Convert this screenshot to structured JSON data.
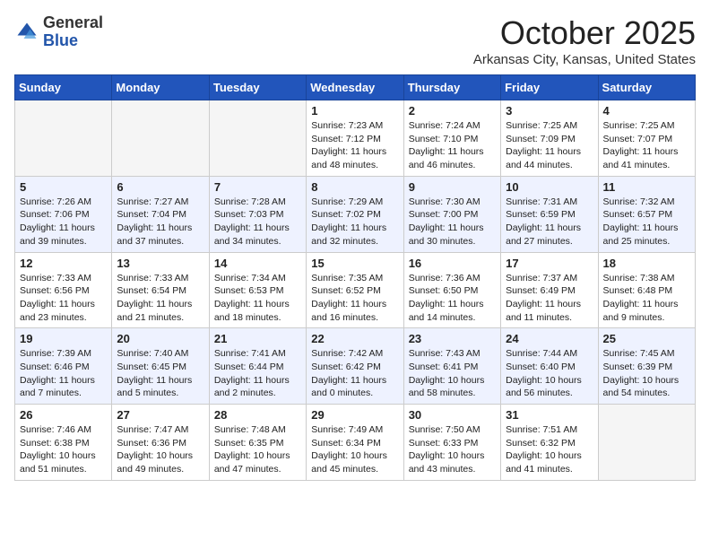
{
  "header": {
    "logo_general": "General",
    "logo_blue": "Blue",
    "month_title": "October 2025",
    "location": "Arkansas City, Kansas, United States"
  },
  "days_of_week": [
    "Sunday",
    "Monday",
    "Tuesday",
    "Wednesday",
    "Thursday",
    "Friday",
    "Saturday"
  ],
  "weeks": [
    [
      {
        "day": "",
        "info": ""
      },
      {
        "day": "",
        "info": ""
      },
      {
        "day": "",
        "info": ""
      },
      {
        "day": "1",
        "info": "Sunrise: 7:23 AM\nSunset: 7:12 PM\nDaylight: 11 hours\nand 48 minutes."
      },
      {
        "day": "2",
        "info": "Sunrise: 7:24 AM\nSunset: 7:10 PM\nDaylight: 11 hours\nand 46 minutes."
      },
      {
        "day": "3",
        "info": "Sunrise: 7:25 AM\nSunset: 7:09 PM\nDaylight: 11 hours\nand 44 minutes."
      },
      {
        "day": "4",
        "info": "Sunrise: 7:25 AM\nSunset: 7:07 PM\nDaylight: 11 hours\nand 41 minutes."
      }
    ],
    [
      {
        "day": "5",
        "info": "Sunrise: 7:26 AM\nSunset: 7:06 PM\nDaylight: 11 hours\nand 39 minutes."
      },
      {
        "day": "6",
        "info": "Sunrise: 7:27 AM\nSunset: 7:04 PM\nDaylight: 11 hours\nand 37 minutes."
      },
      {
        "day": "7",
        "info": "Sunrise: 7:28 AM\nSunset: 7:03 PM\nDaylight: 11 hours\nand 34 minutes."
      },
      {
        "day": "8",
        "info": "Sunrise: 7:29 AM\nSunset: 7:02 PM\nDaylight: 11 hours\nand 32 minutes."
      },
      {
        "day": "9",
        "info": "Sunrise: 7:30 AM\nSunset: 7:00 PM\nDaylight: 11 hours\nand 30 minutes."
      },
      {
        "day": "10",
        "info": "Sunrise: 7:31 AM\nSunset: 6:59 PM\nDaylight: 11 hours\nand 27 minutes."
      },
      {
        "day": "11",
        "info": "Sunrise: 7:32 AM\nSunset: 6:57 PM\nDaylight: 11 hours\nand 25 minutes."
      }
    ],
    [
      {
        "day": "12",
        "info": "Sunrise: 7:33 AM\nSunset: 6:56 PM\nDaylight: 11 hours\nand 23 minutes."
      },
      {
        "day": "13",
        "info": "Sunrise: 7:33 AM\nSunset: 6:54 PM\nDaylight: 11 hours\nand 21 minutes."
      },
      {
        "day": "14",
        "info": "Sunrise: 7:34 AM\nSunset: 6:53 PM\nDaylight: 11 hours\nand 18 minutes."
      },
      {
        "day": "15",
        "info": "Sunrise: 7:35 AM\nSunset: 6:52 PM\nDaylight: 11 hours\nand 16 minutes."
      },
      {
        "day": "16",
        "info": "Sunrise: 7:36 AM\nSunset: 6:50 PM\nDaylight: 11 hours\nand 14 minutes."
      },
      {
        "day": "17",
        "info": "Sunrise: 7:37 AM\nSunset: 6:49 PM\nDaylight: 11 hours\nand 11 minutes."
      },
      {
        "day": "18",
        "info": "Sunrise: 7:38 AM\nSunset: 6:48 PM\nDaylight: 11 hours\nand 9 minutes."
      }
    ],
    [
      {
        "day": "19",
        "info": "Sunrise: 7:39 AM\nSunset: 6:46 PM\nDaylight: 11 hours\nand 7 minutes."
      },
      {
        "day": "20",
        "info": "Sunrise: 7:40 AM\nSunset: 6:45 PM\nDaylight: 11 hours\nand 5 minutes."
      },
      {
        "day": "21",
        "info": "Sunrise: 7:41 AM\nSunset: 6:44 PM\nDaylight: 11 hours\nand 2 minutes."
      },
      {
        "day": "22",
        "info": "Sunrise: 7:42 AM\nSunset: 6:42 PM\nDaylight: 11 hours\nand 0 minutes."
      },
      {
        "day": "23",
        "info": "Sunrise: 7:43 AM\nSunset: 6:41 PM\nDaylight: 10 hours\nand 58 minutes."
      },
      {
        "day": "24",
        "info": "Sunrise: 7:44 AM\nSunset: 6:40 PM\nDaylight: 10 hours\nand 56 minutes."
      },
      {
        "day": "25",
        "info": "Sunrise: 7:45 AM\nSunset: 6:39 PM\nDaylight: 10 hours\nand 54 minutes."
      }
    ],
    [
      {
        "day": "26",
        "info": "Sunrise: 7:46 AM\nSunset: 6:38 PM\nDaylight: 10 hours\nand 51 minutes."
      },
      {
        "day": "27",
        "info": "Sunrise: 7:47 AM\nSunset: 6:36 PM\nDaylight: 10 hours\nand 49 minutes."
      },
      {
        "day": "28",
        "info": "Sunrise: 7:48 AM\nSunset: 6:35 PM\nDaylight: 10 hours\nand 47 minutes."
      },
      {
        "day": "29",
        "info": "Sunrise: 7:49 AM\nSunset: 6:34 PM\nDaylight: 10 hours\nand 45 minutes."
      },
      {
        "day": "30",
        "info": "Sunrise: 7:50 AM\nSunset: 6:33 PM\nDaylight: 10 hours\nand 43 minutes."
      },
      {
        "day": "31",
        "info": "Sunrise: 7:51 AM\nSunset: 6:32 PM\nDaylight: 10 hours\nand 41 minutes."
      },
      {
        "day": "",
        "info": ""
      }
    ]
  ]
}
